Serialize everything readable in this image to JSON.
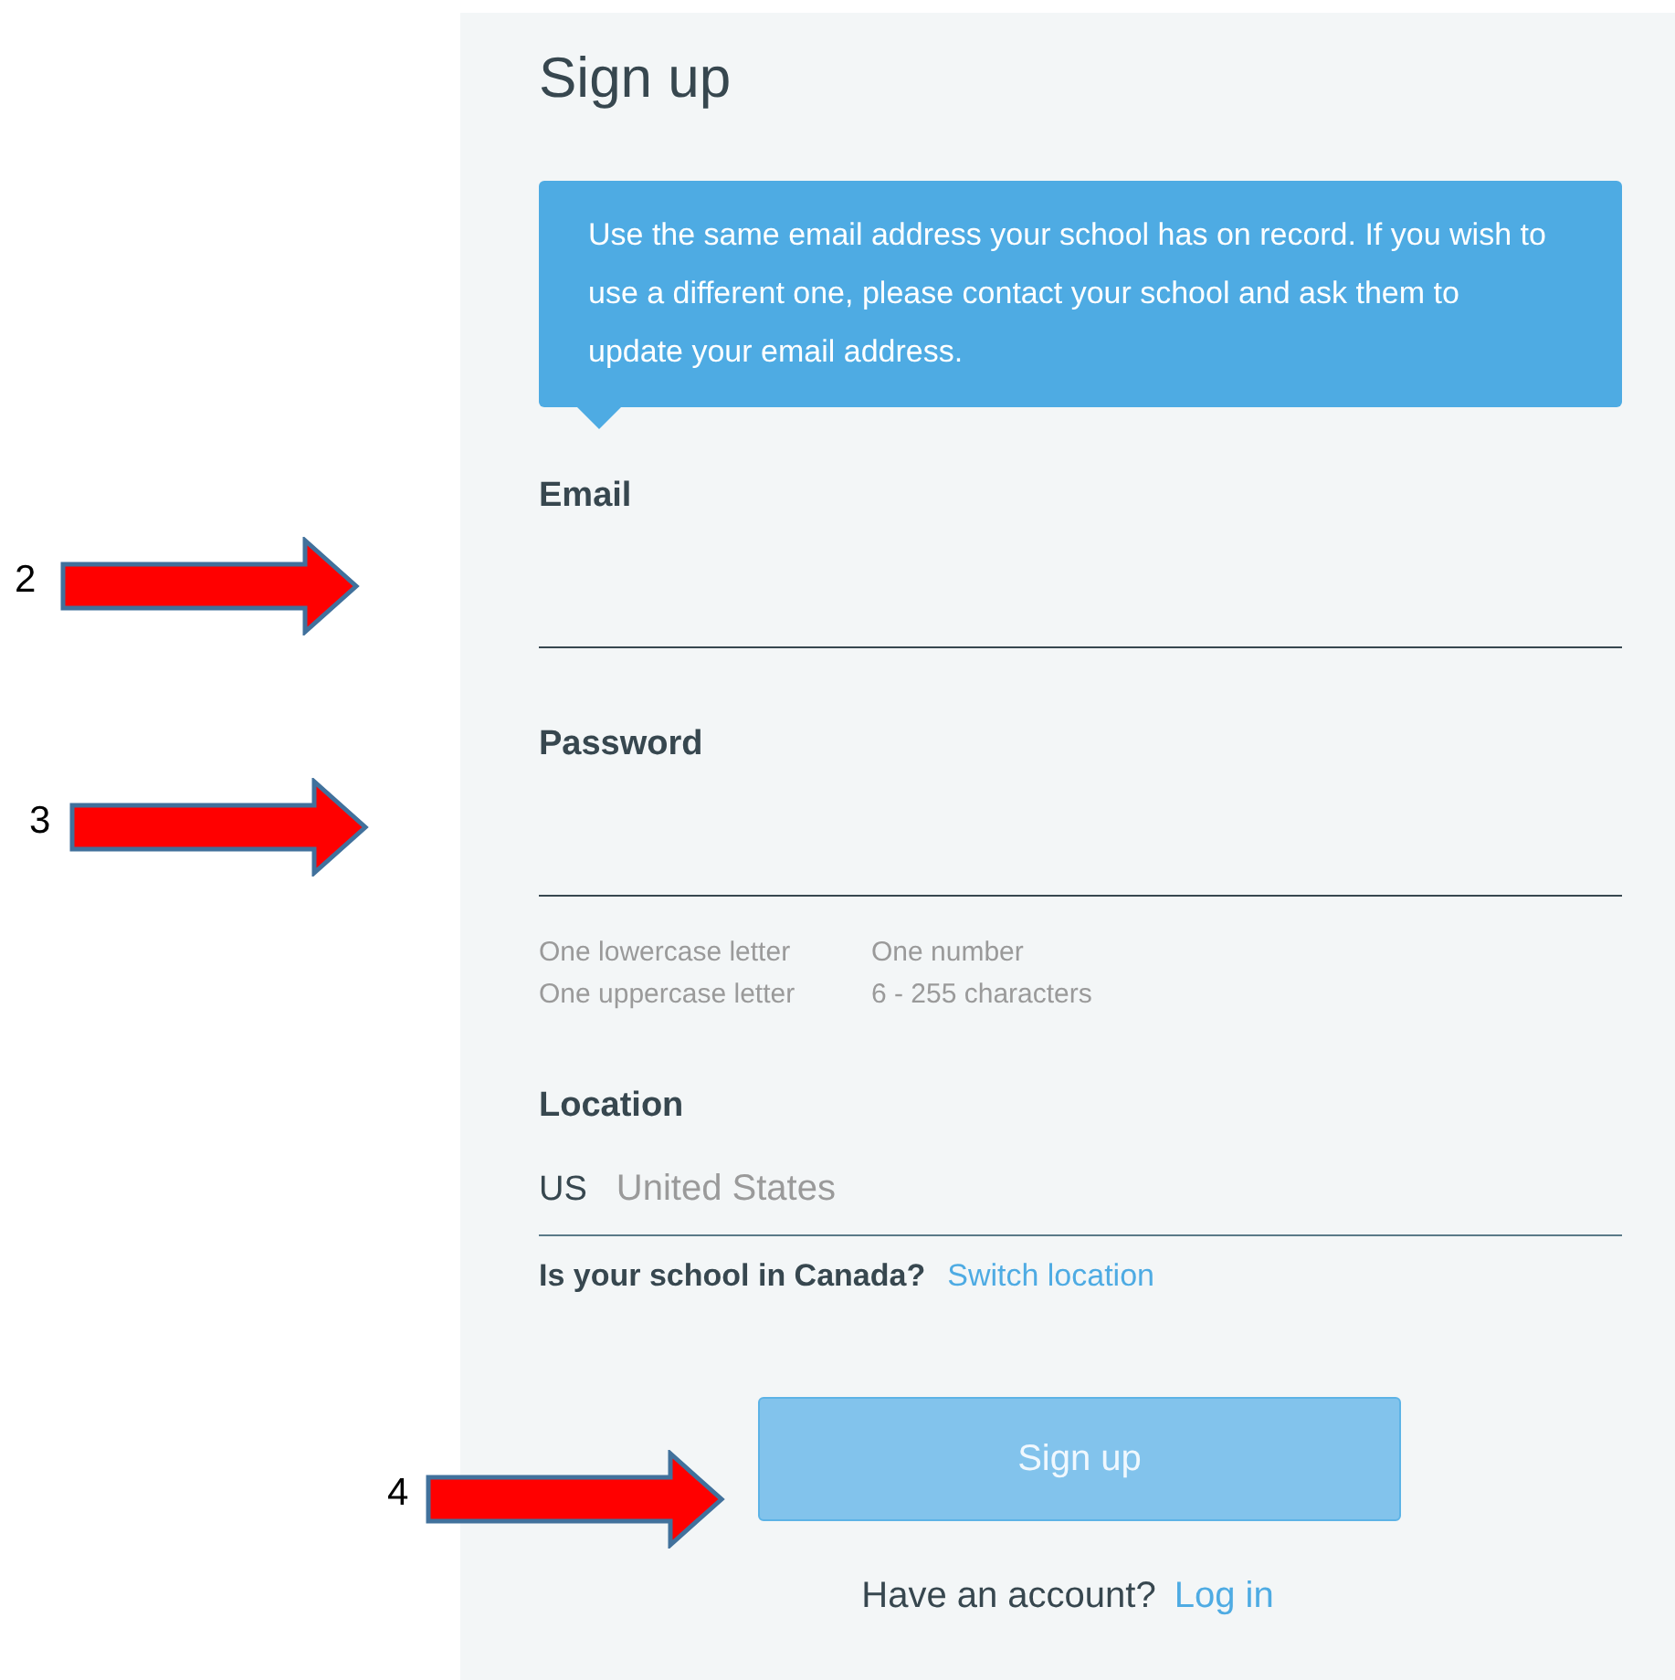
{
  "title": "Sign up",
  "notice": "Use the same email address your school has on record. If you wish to use a different one, please contact your school and ask them to update your email address.",
  "fields": [
    {
      "label": "Email",
      "kind": "text"
    },
    {
      "label": "Password",
      "kind": "password",
      "hints": [
        "One lowercase letter",
        "One number",
        "One uppercase letter",
        "6 - 255 characters"
      ]
    },
    {
      "label": "Location",
      "kind": "location",
      "code": "US",
      "placeholder": "United States"
    }
  ],
  "location_prompt": {
    "text": "Is your school in Canada?",
    "link": "Switch location"
  },
  "submit": {
    "label": "Sign up",
    "disabled": true
  },
  "login_prompt": {
    "text": "Have an account?",
    "link": "Log in"
  },
  "annotations": [
    {
      "label": "2"
    },
    {
      "label": "3"
    },
    {
      "label": "4"
    }
  ]
}
